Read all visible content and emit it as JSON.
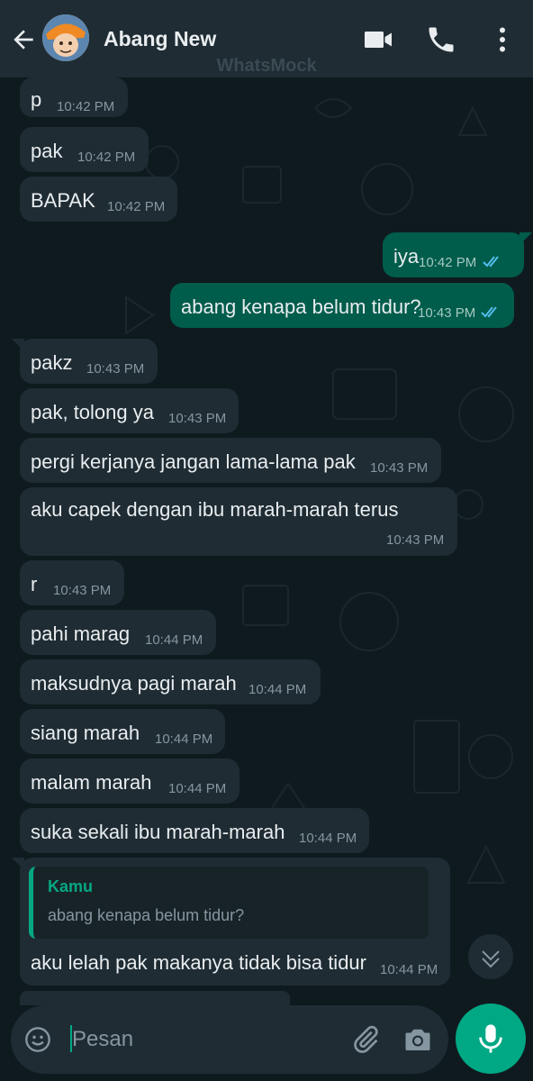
{
  "header": {
    "contact_name": "Abang New",
    "watermark": "WhatsMock"
  },
  "messages": [
    {
      "dir": "in",
      "text": "p",
      "time": "10:42 PM"
    },
    {
      "dir": "in",
      "text": "pak",
      "time": "10:42 PM"
    },
    {
      "dir": "in",
      "text": "BAPAK",
      "time": "10:42 PM"
    },
    {
      "dir": "out",
      "text": "iya",
      "time": "10:42 PM",
      "status": "read"
    },
    {
      "dir": "out",
      "text": "abang kenapa belum tidur?",
      "time": "10:43 PM",
      "status": "read"
    },
    {
      "dir": "in",
      "text": "pakz",
      "time": "10:43 PM"
    },
    {
      "dir": "in",
      "text": "pak, tolong ya",
      "time": "10:43 PM"
    },
    {
      "dir": "in",
      "text": "pergi kerjanya jangan lama-lama pak",
      "time": "10:43 PM"
    },
    {
      "dir": "in",
      "text": "aku capek dengan ibu marah-marah terus",
      "time": "10:43 PM"
    },
    {
      "dir": "in",
      "text": "r",
      "time": "10:43 PM"
    },
    {
      "dir": "in",
      "text": "pahi marag",
      "time": "10:44 PM"
    },
    {
      "dir": "in",
      "text": "maksudnya pagi marah",
      "time": "10:44 PM"
    },
    {
      "dir": "in",
      "text": "siang marah",
      "time": "10:44 PM"
    },
    {
      "dir": "in",
      "text": "malam marah",
      "time": "10:44 PM"
    },
    {
      "dir": "in",
      "text": "suka sekali ibu marah-marah",
      "time": "10:44 PM"
    },
    {
      "dir": "in",
      "text": "aku lelah pak makanya tidak bisa tidur",
      "time": "10:44 PM",
      "quote": {
        "author": "Kamu",
        "text": "abang kenapa belum tidur?"
      }
    }
  ],
  "composer": {
    "placeholder": "Pesan"
  },
  "colors": {
    "header_bg": "#1f2c33",
    "incoming_bubble": "#1f2c33",
    "outgoing_bubble": "#005c4b",
    "accent": "#00a884",
    "read_tick": "#53bdeb"
  },
  "icons": [
    "back-arrow-icon",
    "video-call-icon",
    "phone-icon",
    "more-vert-icon",
    "chevron-down-icon",
    "emoji-icon",
    "attach-icon",
    "camera-icon",
    "mic-icon"
  ]
}
